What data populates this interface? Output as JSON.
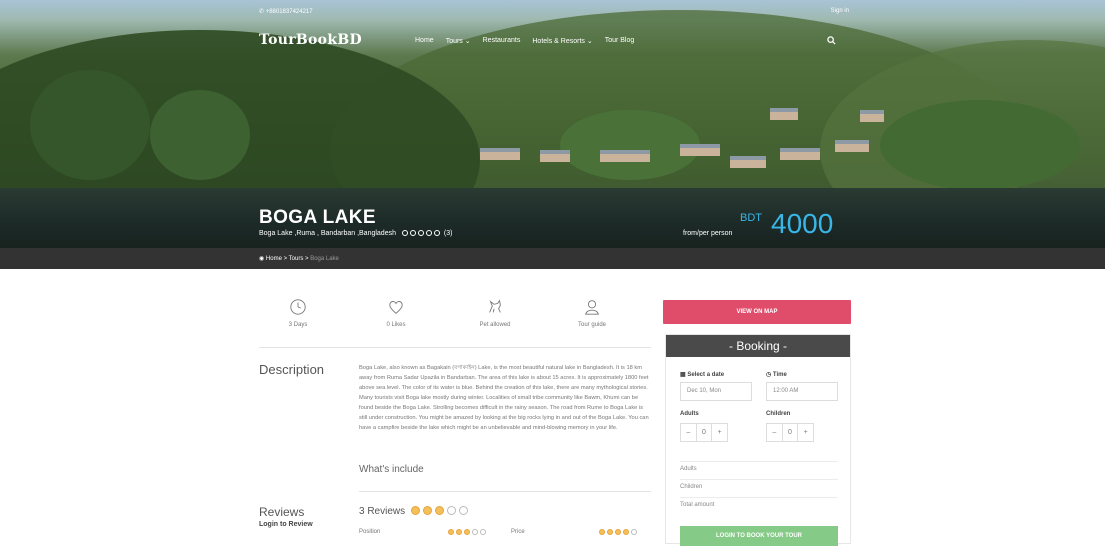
{
  "header": {
    "phone": "+8801837424217",
    "signin": "Sign in",
    "logo": "TourBookBD",
    "menu": [
      "Home",
      "Tours ⌄",
      "Restaurants",
      "Hotels & Resorts ⌄",
      "Tour Blog"
    ],
    "search_icon": "search-icon"
  },
  "hero": {
    "title": "BOGA LAKE",
    "location": "Boga Lake ,Ruma , Bandarban ,Bangladesh",
    "rating_count": "(3)",
    "price_per": "from/per person",
    "currency": "BDT",
    "price": "4000"
  },
  "breadcrumb": {
    "items": [
      "Home",
      "Tours"
    ],
    "current": "Boga Lake"
  },
  "features": [
    {
      "icon": "clock-icon",
      "label": "3 Days"
    },
    {
      "icon": "heart-icon",
      "label": "0 Likes"
    },
    {
      "icon": "pet-icon",
      "label": "Pet allowed"
    },
    {
      "icon": "guide-icon",
      "label": "Tour guide"
    }
  ],
  "description": {
    "title": "Description",
    "text": "Boga Lake, also known as Bagakain (বগাকাইন) Lake, is the most beautiful natural lake in Bangladesh. It is 18 km away from Ruma Sadar Upazila in Bandarban. The area of this lake is about 15 acres. It is approximately 1800 feet above sea level. The color of its water is blue. Behind the creation of this lake, there are many mythological stories. Many tourists visit Boga lake mostly during winter. Localities of small tribe community like Bawm, Khumi can be found beside the Boga Lake. Strolling becomes difficult in the rainy season. The road from Rume to Boga Lake is still under construction. You might be amazed by looking at the big rocks lying in and out of the Boga Lake. You can have a campfire beside the lake which might be an unbelievable and mind-blowing memory in your life.",
    "whats_include": "What's include"
  },
  "reviews": {
    "title": "Reviews",
    "login": "Login to Review",
    "count": "3 Reviews",
    "rating": 3,
    "rows": [
      {
        "label": "Position",
        "rating": 3
      },
      {
        "label": "Price",
        "rating": 4
      }
    ]
  },
  "sidebar": {
    "map_button": "VIEW ON MAP",
    "booking_title": "- Booking -",
    "select_date_label": "Select a date",
    "time_label": "Time",
    "date_value": "Dec 10, Mon",
    "time_value": "12:00 AM",
    "adults_label": "Adults",
    "children_label": "Children",
    "adults_value": "0",
    "children_value": "0",
    "summary": [
      "Adults",
      "Children",
      "Total amount"
    ],
    "book_button": "LOGIN TO BOOK YOUR TOUR"
  },
  "colors": {
    "accent_blue": "#38b6e8",
    "map_button": "#e04d6a",
    "book_button": "#85ca87",
    "breadcrumb_bg": "#333333",
    "booking_head": "#4a4a4a"
  }
}
